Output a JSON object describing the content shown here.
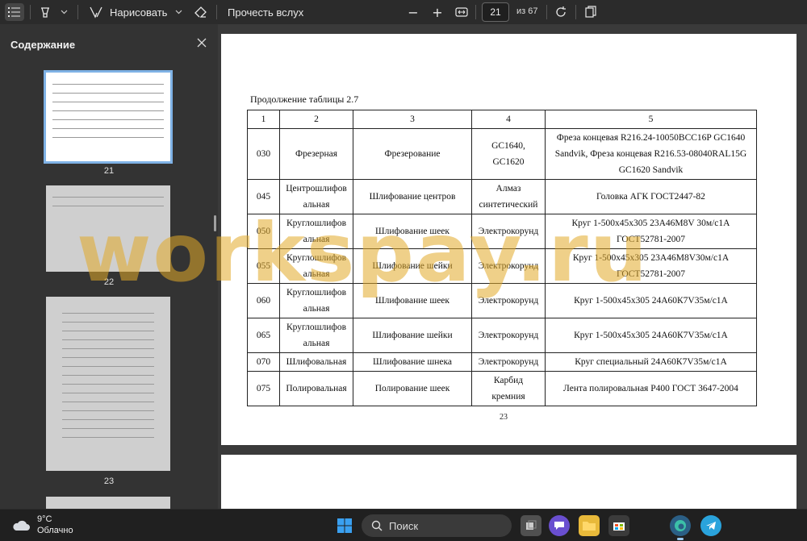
{
  "toolbar": {
    "draw_label": "Нарисовать",
    "read_aloud_label": "Прочесть вслух",
    "zoom_out": "−",
    "zoom_in": "+",
    "current_page": "21",
    "page_of": "из 67"
  },
  "sidebar": {
    "title": "Содержание",
    "thumbnails": [
      {
        "label": "21",
        "selected": true
      },
      {
        "label": "22",
        "selected": false
      },
      {
        "label": "23",
        "selected": false
      }
    ]
  },
  "document": {
    "caption": "Продолжение таблицы 2.7",
    "header": [
      "1",
      "2",
      "3",
      "4",
      "5"
    ],
    "rows": [
      [
        "030",
        "Фрезерная",
        "Фрезерование",
        "GC1640,\nGC1620",
        "Фреза концевая R216.24-10050BCC16P GC1640 Sandvik, Фреза концевая R216.53-08040RAL15G GC1620 Sandvik"
      ],
      [
        "045",
        "Центрошлифов\nальная",
        "Шлифование центров",
        "Алмаз\nсинтетический",
        "Головка АГК ГОСТ2447-82"
      ],
      [
        "050",
        "Круглошлифов\nальная",
        "Шлифование шеек",
        "Электрокорунд",
        "Круг 1-500х45х305 23А46М8V 30м/с1А\nГОСТ52781-2007"
      ],
      [
        "055",
        "Круглошлифов\nальная",
        "Шлифование шейки",
        "Электрокорунд",
        "Круг 1-500х45х305 23А46М8V30м/с1А\nГОСТ52781-2007"
      ],
      [
        "060",
        "Круглошлифов\nальная",
        "Шлифование шеек",
        "Электрокорунд",
        "Круг 1-500х45х305 24А60К7V35м/с1А"
      ],
      [
        "065",
        "Круглошлифов\nальная",
        "Шлифование шейки",
        "Электрокорунд",
        "Круг 1-500х45х305 24А60К7V35м/с1А"
      ],
      [
        "070",
        "Шлифовальная",
        "Шлифование шнека",
        "Электрокорунд",
        "Круг специальный 24А60К7V35м/с1А"
      ],
      [
        "075",
        "Полировальная",
        "Полирование шеек",
        "Карбид\nкремния",
        "Лента полировальная Р400 ГОСТ 3647-2004"
      ]
    ],
    "page_number": "23"
  },
  "watermark": "workspay.ru",
  "taskbar": {
    "weather_temp": "9°C",
    "weather_desc": "Облачно",
    "search_label": "Поиск"
  },
  "colors": {
    "toolbar_bg": "#2b2b2b",
    "sidebar_bg": "#333333",
    "selected_outline": "#7fb2e5",
    "watermark": "#e1aa28"
  }
}
